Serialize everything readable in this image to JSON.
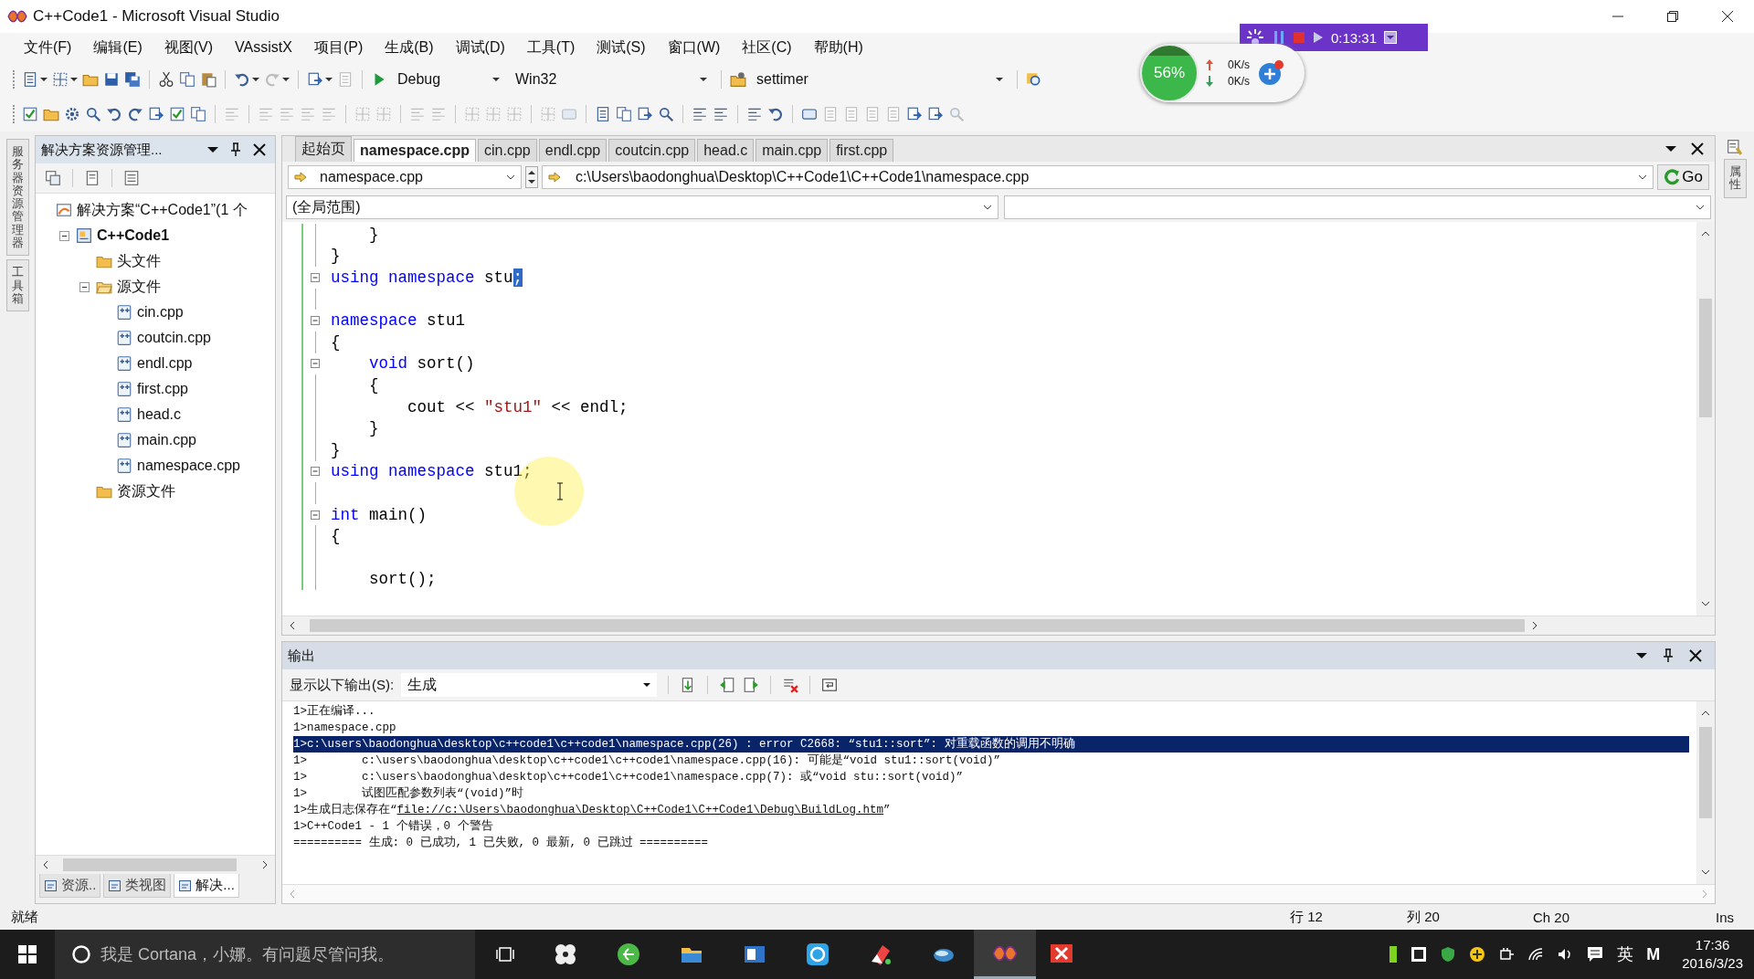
{
  "window": {
    "title": "C++Code1 - Microsoft Visual Studio"
  },
  "menu": [
    "文件(F)",
    "编辑(E)",
    "视图(V)",
    "VAssistX",
    "项目(P)",
    "生成(B)",
    "调试(D)",
    "工具(T)",
    "测试(S)",
    "窗口(W)",
    "社区(C)",
    "帮助(H)"
  ],
  "toolbar": {
    "configuration": "Debug",
    "platform": "Win32",
    "startup": "settimer"
  },
  "recorder": {
    "time": "0:13:31"
  },
  "speed_ball": {
    "percent": "56%",
    "upload": "0K/s",
    "download": "0K/s"
  },
  "side_tabs": {
    "left": [
      "服务器资源管理器",
      "工具箱"
    ],
    "right": [
      "属性"
    ]
  },
  "solution_explorer": {
    "title": "解决方案资源管理...",
    "tree": [
      {
        "label": "解决方案“C++Code1”(1 个",
        "kind": "solution",
        "children": [
          {
            "label": "C++Code1",
            "kind": "project",
            "expanded": true,
            "children": [
              {
                "label": "头文件",
                "kind": "folder"
              },
              {
                "label": "源文件",
                "kind": "folder",
                "expanded": true,
                "children": [
                  {
                    "label": "cin.cpp",
                    "kind": "cpp"
                  },
                  {
                    "label": "coutcin.cpp",
                    "kind": "cpp"
                  },
                  {
                    "label": "endl.cpp",
                    "kind": "cpp"
                  },
                  {
                    "label": "first.cpp",
                    "kind": "cpp"
                  },
                  {
                    "label": "head.c",
                    "kind": "cpp"
                  },
                  {
                    "label": "main.cpp",
                    "kind": "cpp"
                  },
                  {
                    "label": "namespace.cpp",
                    "kind": "cpp"
                  }
                ]
              },
              {
                "label": "资源文件",
                "kind": "folder"
              }
            ]
          }
        ]
      }
    ],
    "bottom_tabs": [
      {
        "label": "资源..",
        "selected": false
      },
      {
        "label": "类视图",
        "selected": false
      },
      {
        "label": "解决...",
        "selected": true
      }
    ]
  },
  "editor": {
    "tabs": [
      {
        "label": "起始页",
        "selected": false
      },
      {
        "label": "namespace.cpp",
        "selected": true
      },
      {
        "label": "cin.cpp",
        "selected": false
      },
      {
        "label": "endl.cpp",
        "selected": false
      },
      {
        "label": "coutcin.cpp",
        "selected": false
      },
      {
        "label": "head.c",
        "selected": false
      },
      {
        "label": "main.cpp",
        "selected": false
      },
      {
        "label": "first.cpp",
        "selected": false
      }
    ],
    "file_combo": "namespace.cpp",
    "path": "c:\\Users\\baodonghua\\Desktop\\C++Code1\\C++Code1\\namespace.cpp",
    "go_button": "Go",
    "scope": "(全局范围)",
    "lines": [
      {
        "fold": false,
        "tokens": [
          {
            "kind": "plain",
            "text": "    }"
          }
        ]
      },
      {
        "fold": false,
        "tokens": [
          {
            "kind": "plain",
            "text": "}"
          }
        ]
      },
      {
        "fold": true,
        "tokens": [
          {
            "kind": "kw",
            "text": "using"
          },
          {
            "kind": "kw",
            "text": " namespace"
          },
          {
            "kind": "plain",
            "text": " stu"
          },
          {
            "kind": "sel",
            "text": ";"
          }
        ]
      },
      {
        "fold": false
      },
      {
        "fold": true,
        "tokens": [
          {
            "kind": "kw",
            "text": "namespace"
          },
          {
            "kind": "plain",
            "text": " stu1"
          }
        ]
      },
      {
        "fold": false,
        "tokens": [
          {
            "kind": "plain",
            "text": "{"
          }
        ]
      },
      {
        "fold": true,
        "tokens": [
          {
            "kind": "kw",
            "text": "    void"
          },
          {
            "kind": "plain",
            "text": " sort()"
          }
        ]
      },
      {
        "fold": false,
        "tokens": [
          {
            "kind": "plain",
            "text": "    {"
          }
        ]
      },
      {
        "fold": false,
        "tokens": [
          {
            "kind": "plain",
            "text": "        cout << "
          },
          {
            "kind": "str",
            "text": "\"stu1\""
          },
          {
            "kind": "plain",
            "text": " << endl;"
          }
        ]
      },
      {
        "fold": false,
        "tokens": [
          {
            "kind": "plain",
            "text": "    }"
          }
        ]
      },
      {
        "fold": false,
        "tokens": [
          {
            "kind": "plain",
            "text": "}"
          }
        ]
      },
      {
        "fold": true,
        "tokens": [
          {
            "kind": "kw",
            "text": "using"
          },
          {
            "kind": "kw",
            "text": " namespace"
          },
          {
            "kind": "plain",
            "text": " stu1;"
          }
        ]
      },
      {
        "fold": false
      },
      {
        "fold": true,
        "tokens": [
          {
            "kind": "kw",
            "text": "int"
          },
          {
            "kind": "plain",
            "text": " main()"
          }
        ]
      },
      {
        "fold": false,
        "tokens": [
          {
            "kind": "plain",
            "text": "{"
          }
        ]
      },
      {
        "fold": false
      },
      {
        "fold": false,
        "tokens": [
          {
            "kind": "plain",
            "text": "    sort();"
          }
        ]
      }
    ]
  },
  "output": {
    "title": "输出",
    "show_label": "显示以下输出(S):",
    "source": "生成",
    "lines": [
      {
        "text": "1>正在编译...",
        "selected": false
      },
      {
        "text": "1>namespace.cpp",
        "selected": false
      },
      {
        "text": "1>c:\\users\\baodonghua\\desktop\\c++code1\\c++code1\\namespace.cpp(26) : error C2668: “stu1::sort”: 对重载函数的调用不明确",
        "selected": true
      },
      {
        "text": "1>        c:\\users\\baodonghua\\desktop\\c++code1\\c++code1\\namespace.cpp(16): 可能是“void stu1::sort(void)”",
        "selected": false
      },
      {
        "text": "1>        c:\\users\\baodonghua\\desktop\\c++code1\\c++code1\\namespace.cpp(7): 或“void stu::sort(void)”",
        "selected": false
      },
      {
        "text": "1>        试图匹配参数列表“(void)”时",
        "selected": false
      },
      {
        "text": "1>生成日志保存在“",
        "link": "file://c:\\Users\\baodonghua\\Desktop\\C++Code1\\C++Code1\\Debug\\BuildLog.htm",
        "after": "”",
        "selected": false
      },
      {
        "text": "1>C++Code1 - 1 个错误，0 个警告",
        "selected": false
      },
      {
        "text": "========== 生成: 0 已成功, 1 已失败, 0 最新, 0 已跳过 ==========",
        "selected": false
      }
    ]
  },
  "status_bar": {
    "message": "就绪",
    "line": "行 12",
    "column": "列 20",
    "char": "Ch 20",
    "mode": "Ins"
  },
  "taskbar": {
    "search_placeholder": "我是 Cortana，小娜。有问题尽管问我。",
    "ime": "英",
    "ime_mode": "M",
    "time": "17:36",
    "date": "2016/3/23"
  }
}
